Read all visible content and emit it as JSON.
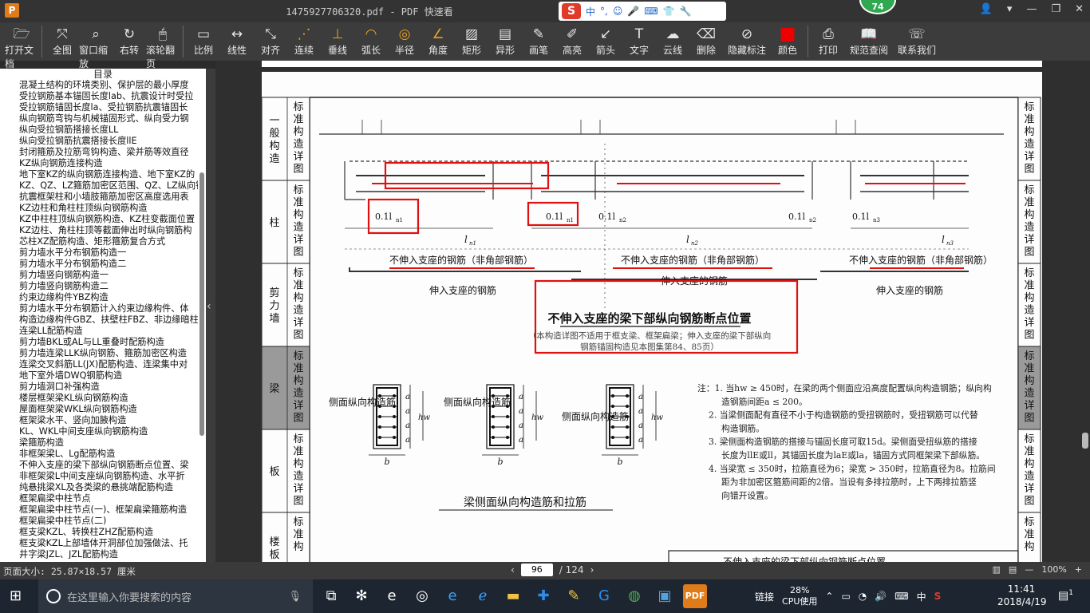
{
  "titlebar": {
    "file_title": "1475927706320.pdf - PDF 快速看",
    "ime": [
      "中",
      "°,",
      "☺",
      "🎤",
      "⌨",
      "👕",
      "🔧"
    ],
    "badge": "74"
  },
  "toolbar": [
    {
      "label": "打开文档",
      "icon": "folder-icon",
      "glyph": "🗁"
    },
    {
      "sep": true
    },
    {
      "label": "全图",
      "icon": "fullview-icon",
      "glyph": "⤧"
    },
    {
      "label": "窗口缩放",
      "icon": "zoom-icon",
      "glyph": "⌕"
    },
    {
      "label": "右转",
      "icon": "rotate-icon",
      "glyph": "↻"
    },
    {
      "label": "滚轮翻页",
      "icon": "mouse-icon",
      "glyph": "🖱"
    },
    {
      "sep": true
    },
    {
      "label": "比例",
      "icon": "scale-icon",
      "glyph": "▭"
    },
    {
      "label": "线性",
      "icon": "linear-icon",
      "glyph": "↔"
    },
    {
      "label": "对齐",
      "icon": "align-icon",
      "glyph": "⤡"
    },
    {
      "label": "连续",
      "icon": "continuous-icon",
      "glyph": "⋰",
      "orange": true
    },
    {
      "label": "垂线",
      "icon": "perpendicular-icon",
      "glyph": "⊥",
      "orange": true
    },
    {
      "label": "弧长",
      "icon": "arc-length-icon",
      "glyph": "◠",
      "orange": true
    },
    {
      "label": "半径",
      "icon": "radius-icon",
      "glyph": "◎",
      "orange": true
    },
    {
      "label": "角度",
      "icon": "angle-icon",
      "glyph": "∠",
      "orange": true
    },
    {
      "label": "矩形",
      "icon": "rectangle-icon",
      "glyph": "▨"
    },
    {
      "label": "异形",
      "icon": "polygon-icon",
      "glyph": "▤"
    },
    {
      "label": "画笔",
      "icon": "pen-icon",
      "glyph": "✎"
    },
    {
      "label": "高亮",
      "icon": "highlight-icon",
      "glyph": "✐"
    },
    {
      "label": "箭头",
      "icon": "arrow-icon",
      "glyph": "↙"
    },
    {
      "label": "文字",
      "icon": "text-icon",
      "glyph": "T"
    },
    {
      "label": "云线",
      "icon": "cloud-icon",
      "glyph": "☁"
    },
    {
      "label": "删除",
      "icon": "eraser-icon",
      "glyph": "⌫"
    },
    {
      "label": "隐藏标注",
      "icon": "hide-icon",
      "glyph": "⊘",
      "wide": true
    },
    {
      "label": "颜色",
      "icon": "color-icon",
      "glyph": "■",
      "red": true
    },
    {
      "sep": true
    },
    {
      "label": "打印",
      "icon": "print-icon",
      "glyph": "⎙"
    },
    {
      "label": "规范查阅",
      "icon": "book-icon",
      "glyph": "📖",
      "wide": true
    },
    {
      "label": "联系我们",
      "icon": "contact-icon",
      "glyph": "☏",
      "wide": true
    }
  ],
  "sidebar": {
    "title": "目录",
    "items": [
      "混凝土结构的环境类别、保护层的最小厚度",
      "受拉钢筋基本锚固长度lab、抗震设计时受拉",
      "受拉钢筋锚固长度la、受拉钢筋抗震锚固长",
      "纵向钢筋弯钩与机械锚固形式、纵向受力钢",
      "纵向受拉钢筋搭接长度LL",
      "纵向受拉钢筋抗震搭接长度llE",
      "封闭箍筋及拉筋弯钩构造、梁并筋等效直径",
      "KZ纵向钢筋连接构造",
      "地下室KZ的纵向钢筋连接构造、地下室KZ的",
      "KZ、QZ、LZ箍筋加密区范围、QZ、LZ纵向钢",
      "抗震框架柱和小墙肢箍筋加密区高度选用表",
      "KZ边柱和角柱柱顶纵向钢筋构造",
      "KZ中柱柱顶纵向钢筋构造、KZ柱变截面位置",
      "KZ边柱、角柱柱顶等截面伸出时纵向钢筋构",
      "芯柱XZ配筋构造、矩形箍筋复合方式",
      "剪力墙水平分布钢筋构造一",
      "剪力墙水平分布钢筋构造二",
      "剪力墙竖向钢筋构造一",
      "剪力墙竖向钢筋构造二",
      "约束边缘构件YBZ构造",
      "剪力墙水平分布钢筋计入约束边缘构件、体",
      "构造边缘构件GBZ、扶壁柱FBZ、非边缘暗柱",
      "连梁LL配筋构造",
      "剪力墙BKL或AL与LL重叠时配筋构造",
      "剪力墙连梁LLK纵向钢筋、箍筋加密区构造",
      "连梁交叉斜筋LL(JX)配筋构造、连梁集中对",
      "地下室外墙DWQ钢筋构造",
      "剪力墙洞口补强构造",
      "楼层框架梁KL纵向钢筋构造",
      "屋面框架梁WKL纵向钢筋构造",
      "框架梁水平、竖向加腋构造",
      "KL、WKL中间支座纵向钢筋构造",
      "梁箍筋构造",
      "非框架梁L、Lg配筋构造",
      "不伸入支座的梁下部纵向钢筋断点位置、梁",
      "非框架梁L中间支座纵向钢筋构造、水平折",
      "纯悬挑梁XL及各类梁的悬挑端配筋构造",
      "框架扁梁中柱节点",
      "框架扁梁中柱节点(一)、框架扁梁箍筋构造",
      "框架扁梁中柱节点(二)",
      "框支梁KZL、转换柱ZHZ配筋构造",
      "框支梁KZL上部墙体开洞部位加强做法、托",
      "井字梁JZL、JZL配筋构造"
    ]
  },
  "document": {
    "left_tabs": [
      {
        "vertical_text": "标准构造详图",
        "side_label": "一般构造",
        "active": false
      },
      {
        "vertical_text": "标准构造详图",
        "side_label": "柱",
        "active": false
      },
      {
        "vertical_text": "标准构造详图",
        "side_label": "剪力墙",
        "active": false
      },
      {
        "vertical_text": "标准构造详图",
        "side_label": "梁",
        "active": true
      },
      {
        "vertical_text": "标准构造详图",
        "side_label": "板",
        "active": false
      },
      {
        "vertical_text": "标准构",
        "side_label": "楼板相",
        "active": false
      }
    ],
    "right_tabs": [
      "标准构造详图",
      "标准构造详图",
      "标准构造详图",
      "标准构造详图",
      "标准构造详图",
      "标准构"
    ],
    "dim_labels": [
      "0.1l",
      "0.1l",
      "0.1l",
      "0.1l",
      "0.1l"
    ],
    "dim_subscripts": [
      "n1",
      "n1",
      "n2",
      "n2",
      "n3"
    ],
    "span_labels": [
      "l",
      "l",
      "l"
    ],
    "span_subscripts": [
      "n1",
      "n2",
      "n3"
    ],
    "bar_labels": [
      "不伸入支座的钢筋（非角部钢筋）",
      "不伸入支座的钢筋（非角部钢筋）",
      "不伸入支座的钢筋（非角部钢筋）"
    ],
    "support_labels": [
      "伸入支座的钢筋",
      "伸入支座的钢筋",
      "伸入支座的钢筋"
    ],
    "main_title": "不伸入支座的梁下部纵向钢筋断点位置",
    "main_note_1": "（本构造详图不适用于框支梁、框架扁梁；伸入支座的梁下部纵向",
    "main_note_2": "钢筋锚固构造见本图集第84、85页）",
    "section_labels": [
      "侧面纵向构造筋",
      "侧面纵向构造筋",
      "侧面纵向构造筋"
    ],
    "section_symbols": {
      "a": "a",
      "b": "b",
      "hw": "hw"
    },
    "bottom_title": "梁侧面纵向构造筋和拉筋",
    "notes": [
      "注：1. 当hw ≥ 450时，在梁的两个侧面应沿高度配置纵向构造钢筋；纵向构",
      "造钢筋间距a ≤ 200。",
      "2. 当梁侧面配有直径不小于构造钢筋的受扭钢筋时，受扭钢筋可以代替",
      "构造钢筋。",
      "3. 梁侧面构造钢筋的搭接与锚固长度可取15d。梁侧面受扭纵筋的搭接",
      "长度为llE或ll，其锚固长度为laE或la，锚固方式同框架梁下部纵筋。",
      "4. 当梁宽 ≤ 350时，拉筋直径为6；梁宽 > 350时，拉筋直径为8。拉筋间",
      "距为非加密区箍筋间距的2倍。当设有多排拉筋时，上下两排拉筋竖",
      "向错开设置。"
    ],
    "footer_text": "不伸入支座的梁下部纵向钢筋断点位置",
    "annotation_color": "#e01010",
    "rebar_color": "#e01010"
  },
  "statusbar": {
    "page_size": "页面大小: 25.87×18.57 厘米",
    "current_page": "96",
    "total_pages": "/ 124",
    "zoom": "100%"
  },
  "taskbar": {
    "search_placeholder": "在这里输入你要搜索的内容",
    "tray_link": "链接",
    "cpu_percent": "28%",
    "cpu_label": "CPU使用",
    "ime_lang": "中",
    "time": "11:41",
    "date": "2018/4/19",
    "notifications": "1"
  }
}
